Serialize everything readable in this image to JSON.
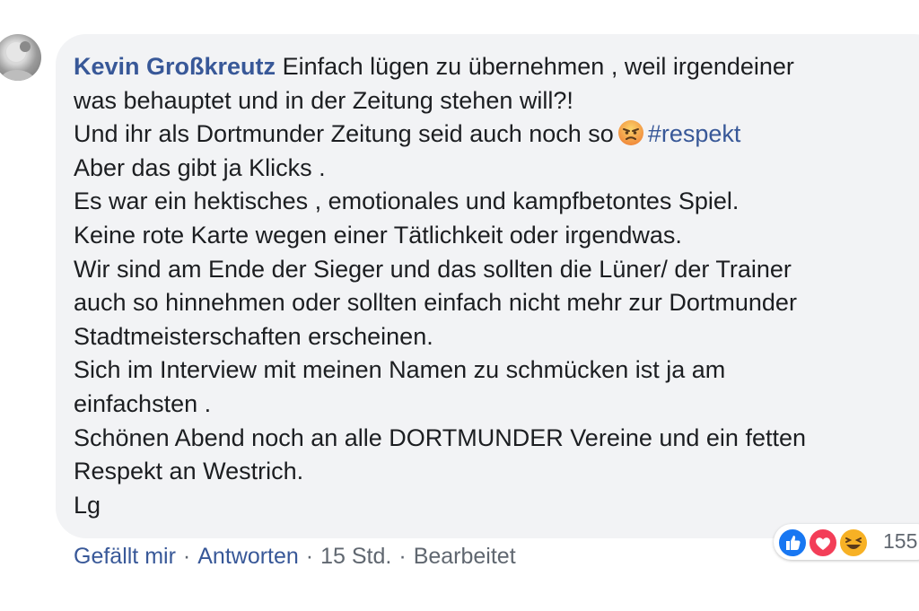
{
  "comment": {
    "author": "Kevin Großkreutz",
    "lines": [
      "Einfach lügen zu übernehmen , weil irgendeiner",
      "was behauptet und in der Zeitung stehen will?!",
      "Und ihr als Dortmunder Zeitung seid auch noch so",
      "Aber das gibt ja Klicks .",
      "Es war ein hektisches , emotionales und kampfbetontes Spiel.",
      "Keine rote Karte wegen einer Tätlichkeit oder irgendwas.",
      "Wir sind am Ende der Sieger und das sollten die Lüner/ der Trainer",
      "auch so hinnehmen oder sollten einfach nicht mehr zur Dortmunder",
      "Stadtmeisterschaften erscheinen.",
      "Sich im Interview mit meinen Namen zu schmücken ist ja am",
      "einfachsten .",
      "Schönen Abend noch an alle DORTMUNDER Vereine und ein fetten",
      "Respekt an Westrich.",
      "Lg"
    ],
    "emoji": "angry-face-emoji",
    "hashtag": "#respekt"
  },
  "actions": {
    "like": "Gefällt mir",
    "reply": "Antworten",
    "time": "15 Std.",
    "edited": "Bearbeitet",
    "separator": "·"
  },
  "reactions": {
    "icons": [
      "like-icon",
      "love-icon",
      "haha-icon"
    ],
    "count": "155"
  },
  "colors": {
    "link": "#385898",
    "bubble": "#f2f3f5",
    "text": "#1c1e21",
    "meta": "#606770"
  }
}
